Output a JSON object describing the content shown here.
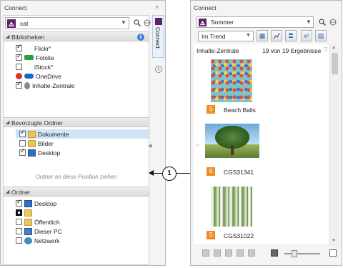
{
  "left": {
    "title": "Connect",
    "close_glyph": "×",
    "search_value": "cat",
    "libraries": {
      "heading": "Bibliotheken",
      "items": [
        {
          "label": "Flickr°",
          "checked": true,
          "icon": "blank"
        },
        {
          "label": "Fotolia",
          "checked": true,
          "icon": "stock-icon"
        },
        {
          "label": "iStock°",
          "checked": false,
          "icon": "blank"
        },
        {
          "label": "OneDrive",
          "checked": null,
          "icon": "cloud-icon"
        },
        {
          "label": "Inhalte-Zentrale",
          "checked": true,
          "icon": "pin-icon"
        }
      ]
    },
    "favorites": {
      "heading": "Bevorzugte Ordner",
      "items": [
        {
          "label": "Dokumente",
          "checked": true
        },
        {
          "label": "Bilder",
          "checked": false
        },
        {
          "label": "Desktop",
          "checked": true
        }
      ],
      "hint": "Ordner an diese Position ziehen"
    },
    "folders": {
      "heading": "Ordner",
      "items": [
        {
          "label": "Desktop",
          "checked": true
        },
        {
          "label": "",
          "checked": "partial"
        },
        {
          "label": "Öffentlich",
          "checked": false
        },
        {
          "label": "Dieser PC",
          "checked": false
        },
        {
          "label": "Netzwerk",
          "checked": false
        }
      ]
    },
    "side_tab": "Connect"
  },
  "callout": {
    "number": "1"
  },
  "right": {
    "title": "Connect",
    "search_value": "Sommer",
    "sort_value": "Im Trend",
    "content_heading": "Inhalte-Zentrale",
    "result_count": "19 von 19 Ergebnisse",
    "results": [
      {
        "name": "Beach Balls",
        "badge": "S"
      },
      {
        "name": "CGS31341",
        "badge": "S"
      },
      {
        "name": "CGS31022",
        "badge": "S"
      }
    ]
  },
  "colors": {
    "brand": "#5b2067",
    "badge": "#f18c22",
    "selection": "#cde4f9"
  }
}
